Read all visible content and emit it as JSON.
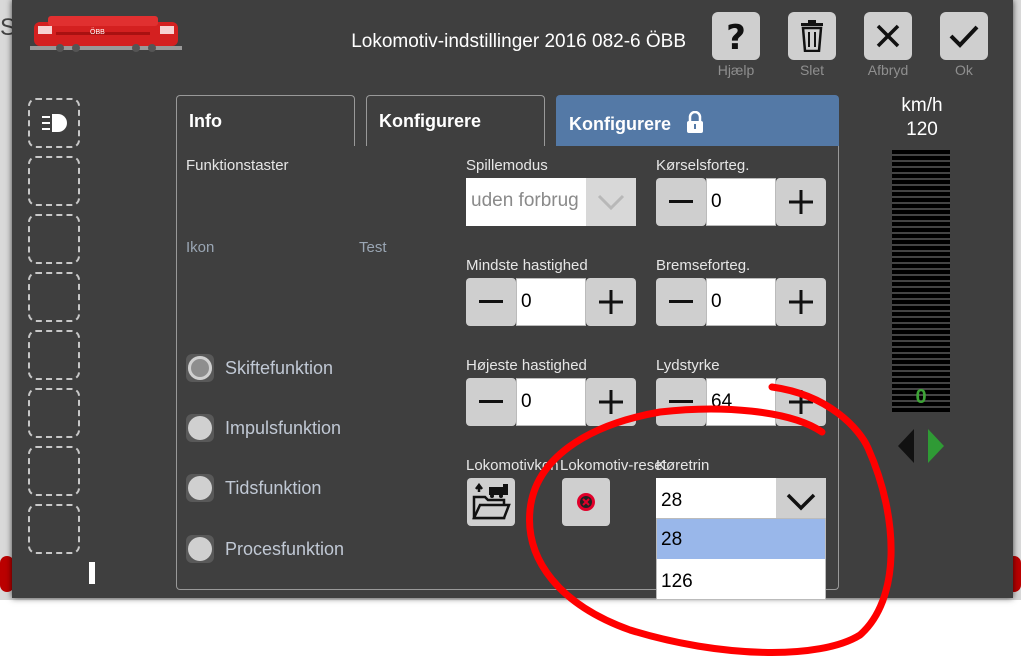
{
  "app": {
    "title": "Lokomotiv-indstillinger 2016 082-6 ÖBB",
    "background_text": "S",
    "logo_text": "ÖBB"
  },
  "toolbar": {
    "help_label": "Hjælp",
    "delete_label": "Slet",
    "cancel_label": "Afbryd",
    "ok_label": "Ok"
  },
  "tabs": [
    {
      "label": "Info"
    },
    {
      "label": "Konfigurere"
    },
    {
      "label": "Konfigurere"
    }
  ],
  "functions": {
    "heading": "Funktionstaster",
    "col_icon": "Ikon",
    "col_test": "Test",
    "modes": [
      {
        "label": "Skiftefunktion",
        "selected": true
      },
      {
        "label": "Impulsfunktion",
        "selected": false
      },
      {
        "label": "Tidsfunktion",
        "selected": false
      },
      {
        "label": "Procesfunktion",
        "selected": false
      }
    ]
  },
  "fields": {
    "play_mode": {
      "label": "Spillemodus",
      "value": "uden forbrug"
    },
    "accel": {
      "label": "Kørselsforteg.",
      "value": "0"
    },
    "min_speed": {
      "label": "Mindste hastighed",
      "value": "0"
    },
    "brake": {
      "label": "Bremseforteg.",
      "value": "0"
    },
    "max_speed": {
      "label": "Højeste hastighed",
      "value": "0"
    },
    "volume": {
      "label": "Lydstyrke",
      "value": "64"
    },
    "loco_cv": {
      "label": "Lokomotivkon"
    },
    "loco_reset": {
      "label": "Lokomotiv-reset"
    },
    "speed_steps": {
      "label": "Køretrin",
      "value": "28",
      "options": [
        "28",
        "126"
      ],
      "highlighted": "28"
    }
  },
  "speed": {
    "unit": "km/h",
    "max": "120",
    "current": "0",
    "current_fraction": 0
  },
  "colors": {
    "accent_tab": "#5479a6",
    "speed_green": "#3da336",
    "annotation_red": "#ff0000"
  }
}
